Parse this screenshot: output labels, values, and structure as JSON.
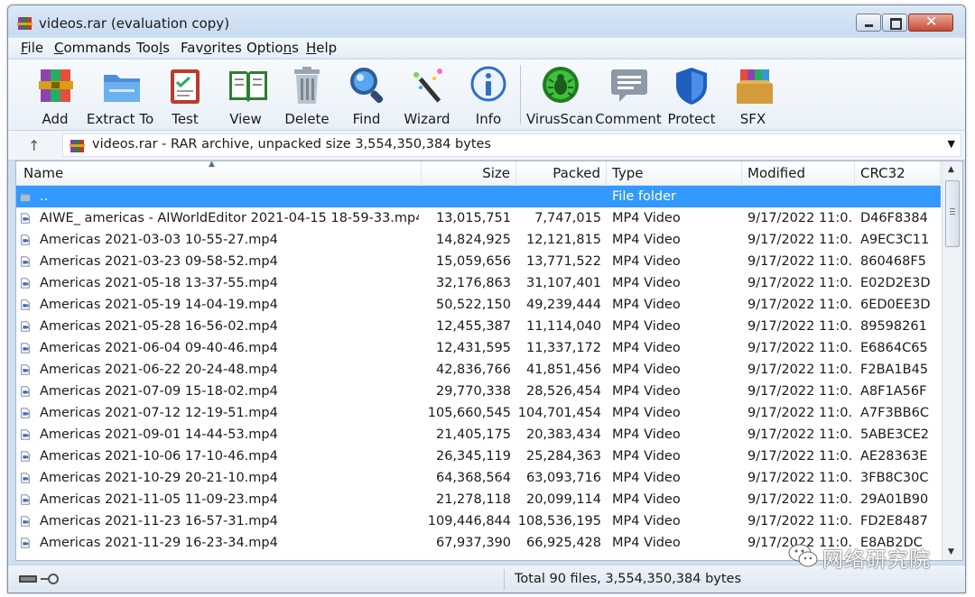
{
  "window": {
    "title": "videos.rar (evaluation copy)"
  },
  "menu": [
    {
      "label": "File",
      "accel": "F",
      "rest": "ile"
    },
    {
      "label": "Commands",
      "accel": "C",
      "rest": "ommands"
    },
    {
      "label": "Tools",
      "pre": "Too",
      "accel": "l",
      "rest": "s"
    },
    {
      "label": "Favorites",
      "pre": "Fav",
      "accel": "o",
      "rest": "rites"
    },
    {
      "label": "Options",
      "pre": "Optio",
      "accel": "n",
      "rest": "s"
    },
    {
      "label": "Help",
      "accel": "H",
      "rest": "elp"
    }
  ],
  "toolbar": [
    {
      "label": "Add",
      "icon": "add-archive-icon"
    },
    {
      "label": "Extract To",
      "icon": "extract-folder-icon"
    },
    {
      "label": "Test",
      "icon": "test-clipboard-icon"
    },
    {
      "label": "View",
      "icon": "view-book-icon"
    },
    {
      "label": "Delete",
      "icon": "trash-can-icon"
    },
    {
      "label": "Find",
      "icon": "magnifier-icon"
    },
    {
      "label": "Wizard",
      "icon": "magic-wand-icon"
    },
    {
      "label": "Info",
      "icon": "info-icon"
    },
    {
      "label": "VirusScan",
      "icon": "bug-scan-icon"
    },
    {
      "label": "Comment",
      "icon": "comment-bubble-icon"
    },
    {
      "label": "Protect",
      "icon": "shield-icon"
    },
    {
      "label": "SFX",
      "icon": "sfx-box-icon"
    }
  ],
  "address": {
    "path": "videos.rar - RAR archive, unpacked size 3,554,350,384 bytes"
  },
  "columns": {
    "name": "Name",
    "size": "Size",
    "packed": "Packed",
    "type": "Type",
    "modified": "Modified",
    "crc": "CRC32"
  },
  "rows": [
    {
      "name": "..",
      "size": "",
      "packed": "",
      "type": "File folder",
      "modified": "",
      "crc": "",
      "selected": true,
      "kind": "folder"
    },
    {
      "name": "AIWE_ americas - AIWorldEditor 2021-04-15 18-59-33.mp4",
      "size": "13,015,751",
      "packed": "7,747,015",
      "type": "MP4 Video",
      "modified": "9/17/2022 11:0...",
      "crc": "D46F8384"
    },
    {
      "name": "Americas 2021-03-03 10-55-27.mp4",
      "size": "14,824,925",
      "packed": "12,121,815",
      "type": "MP4 Video",
      "modified": "9/17/2022 11:0...",
      "crc": "A9EC3C11"
    },
    {
      "name": "Americas 2021-03-23 09-58-52.mp4",
      "size": "15,059,656",
      "packed": "13,771,522",
      "type": "MP4 Video",
      "modified": "9/17/2022 11:0...",
      "crc": "860468F5"
    },
    {
      "name": "Americas 2021-05-18 13-37-55.mp4",
      "size": "32,176,863",
      "packed": "31,107,401",
      "type": "MP4 Video",
      "modified": "9/17/2022 11:0...",
      "crc": "E02D2E3D"
    },
    {
      "name": "Americas 2021-05-19 14-04-19.mp4",
      "size": "50,522,150",
      "packed": "49,239,444",
      "type": "MP4 Video",
      "modified": "9/17/2022 11:0...",
      "crc": "6ED0EE3D"
    },
    {
      "name": "Americas 2021-05-28 16-56-02.mp4",
      "size": "12,455,387",
      "packed": "11,114,040",
      "type": "MP4 Video",
      "modified": "9/17/2022 11:0...",
      "crc": "89598261"
    },
    {
      "name": "Americas 2021-06-04 09-40-46.mp4",
      "size": "12,431,595",
      "packed": "11,337,172",
      "type": "MP4 Video",
      "modified": "9/17/2022 11:0...",
      "crc": "E6864C65"
    },
    {
      "name": "Americas 2021-06-22 20-24-48.mp4",
      "size": "42,836,766",
      "packed": "41,851,456",
      "type": "MP4 Video",
      "modified": "9/17/2022 11:0...",
      "crc": "F2BA1B45"
    },
    {
      "name": "Americas 2021-07-09 15-18-02.mp4",
      "size": "29,770,338",
      "packed": "28,526,454",
      "type": "MP4 Video",
      "modified": "9/17/2022 11:0...",
      "crc": "A8F1A56F"
    },
    {
      "name": "Americas 2021-07-12 12-19-51.mp4",
      "size": "105,660,545",
      "packed": "104,701,454",
      "type": "MP4 Video",
      "modified": "9/17/2022 11:0...",
      "crc": "A7F3BB6C"
    },
    {
      "name": "Americas 2021-09-01 14-44-53.mp4",
      "size": "21,405,175",
      "packed": "20,383,434",
      "type": "MP4 Video",
      "modified": "9/17/2022 11:0...",
      "crc": "5ABE3CE2"
    },
    {
      "name": "Americas 2021-10-06 17-10-46.mp4",
      "size": "26,345,119",
      "packed": "25,284,363",
      "type": "MP4 Video",
      "modified": "9/17/2022 11:0...",
      "crc": "AE28363E"
    },
    {
      "name": "Americas 2021-10-29 20-21-10.mp4",
      "size": "64,368,564",
      "packed": "63,093,716",
      "type": "MP4 Video",
      "modified": "9/17/2022 11:0...",
      "crc": "3FB8C30C"
    },
    {
      "name": "Americas 2021-11-05 11-09-23.mp4",
      "size": "21,278,118",
      "packed": "20,099,114",
      "type": "MP4 Video",
      "modified": "9/17/2022 11:0...",
      "crc": "29A01B90"
    },
    {
      "name": "Americas 2021-11-23 16-57-31.mp4",
      "size": "109,446,844",
      "packed": "108,536,195",
      "type": "MP4 Video",
      "modified": "9/17/2022 11:0...",
      "crc": "FD2E8487"
    },
    {
      "name": "Americas 2021-11-29 16-23-34.mp4",
      "size": "67,937,390",
      "packed": "66,925,428",
      "type": "MP4 Video",
      "modified": "9/17/2022 11:0...",
      "crc": "E8AB2DC"
    }
  ],
  "status": {
    "summary": "Total 90 files, 3,554,350,384 bytes"
  },
  "watermark": {
    "text": "网络研究院"
  },
  "colors": {
    "selection": "#3399ff",
    "title_bar": "#c8dbf0",
    "close_button": "#c74a35"
  }
}
